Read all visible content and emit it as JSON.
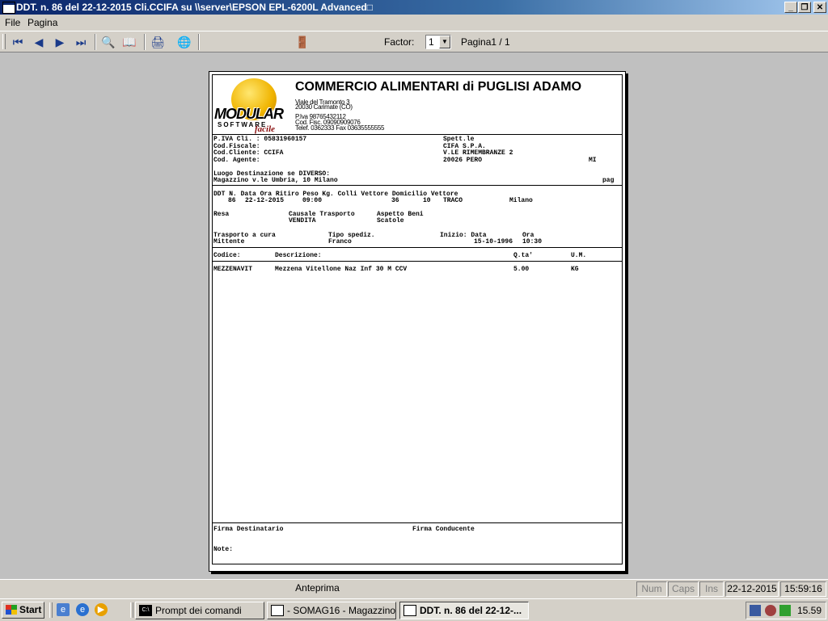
{
  "window": {
    "title": "DDT. n.  86 del 22-12-2015 Cli.CCIFA su \\\\server\\EPSON EPL-6200L Advanced□",
    "minimize": "_",
    "maximize": "❐",
    "close": "✕"
  },
  "menu": {
    "file": "File",
    "pagina": "Pagina"
  },
  "toolbar": {
    "first_icon": "⏮",
    "prev_icon": "◀",
    "next_icon": "▶",
    "last_icon": "⏭",
    "zoom_icon": "🔍",
    "book_icon": "📖",
    "print_icon": "🖨",
    "export_icon": "🌐",
    "exit_icon": "🚪",
    "factor_label": "Factor:",
    "factor_value": "1",
    "page_label": "Pagina1 / 1"
  },
  "document": {
    "logo_text": "MODULAR",
    "logo_sub": "SOFTWARE",
    "logo_script": "facile",
    "company_name": "COMMERCIO ALIMENTARI di PUGLISI ADAMO",
    "company_address1": "Viale del Tramonto 3",
    "company_address2": "20030 Carimate (CO)",
    "company_piva": "P.Iva 98765432112",
    "company_codfisc": "Cod. Fisc. 09090909076",
    "company_tel": "Telef. 0362333     Fax 03635555555",
    "piva_cli": "P.IVA Cli. : 05831960157",
    "cod_fiscale": "Cod.Fiscale:",
    "cod_cliente": "Cod.Cliente: CCIFA",
    "cod_agente": "Cod. Agente:",
    "spett": "Spett.le",
    "cli_name": "CIFA S.P.A.",
    "cli_address": "V.LE RIMEMBRANZE 2",
    "cli_cap_city": "20026   PERO",
    "cli_prov": "MI",
    "dest_label": "Luogo Destinazione se DIVERSO:",
    "dest_value": "Magazzino v.le Umbria, 10 Milano",
    "pag_label": "pag",
    "row1_headers": "DDT N. Data      Ora Ritiro  Peso Kg.    Colli   Vettore         Domicilio Vettore",
    "ddt_n": "86",
    "ddt_date": "22-12-2015",
    "ora_ritiro": "09:00",
    "peso": "36",
    "colli": "10",
    "vettore": "TRACO",
    "domicilio_vettore": "Milano",
    "resa_label": "Resa",
    "causale_label": "Causale Trasporto",
    "aspetto_label": "Aspetto Beni",
    "causale_value": "VENDITA",
    "aspetto_value": "Scatole",
    "trasporto_label": "Trasporto a cura",
    "tipo_label": "Tipo spediz.",
    "inizio_label": "Inizio: Data",
    "ora_label": "Ora",
    "trasporto_value": "Mittente",
    "tipo_value": "Franco",
    "inizio_date": "15-10-1996",
    "inizio_time": "10:30",
    "col_codice": "Codice:",
    "col_descr": "Descrizione:",
    "col_qta": "Q.ta'",
    "col_um": "U.M.",
    "items": [
      {
        "codice": "MEZZENAVIT",
        "descrizione": "Mezzena Vitellone Naz Inf 30 M CCV",
        "qta": "5.00",
        "um": "KG"
      }
    ],
    "firma_dest": "Firma Destinatario",
    "firma_cond": "Firma Conducente",
    "note": "Note:"
  },
  "status": {
    "mode": "Anteprima",
    "num": "Num",
    "caps": "Caps",
    "ins": "Ins",
    "date": "22-12-2015",
    "time": "15:59:16"
  },
  "taskbar": {
    "start": "Start",
    "tasks": [
      {
        "label": "Prompt dei comandi"
      },
      {
        "label": "- SOMAG16 - Magazzino ..."
      },
      {
        "label": "DDT. n.  86 del 22-12-..."
      }
    ],
    "clock": "15.59"
  }
}
